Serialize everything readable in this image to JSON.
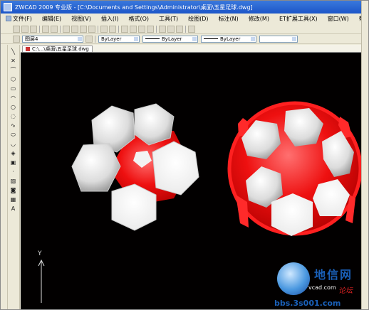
{
  "window": {
    "title": "ZWCAD 2009 专业版 - [C:\\Documents and Settings\\Administrator\\桌面\\五星足球.dwg]"
  },
  "menu": [
    {
      "label": "文件(F)"
    },
    {
      "label": "编辑(E)"
    },
    {
      "label": "视图(V)"
    },
    {
      "label": "插入(I)"
    },
    {
      "label": "格式(O)"
    },
    {
      "label": "工具(T)"
    },
    {
      "label": "绘图(D)"
    },
    {
      "label": "标注(N)"
    },
    {
      "label": "修改(M)"
    },
    {
      "label": "ET扩展工具(X)"
    },
    {
      "label": "窗口(W)"
    },
    {
      "label": "帮助(H)"
    }
  ],
  "toolbar": {
    "layer_value": "图层4",
    "color_value": "ByLayer",
    "linetype_value": "ByLayer",
    "lineweight_value": "ByLayer"
  },
  "document": {
    "tab_label": "C:\\...\\桌面\\五星足球.dwg"
  },
  "ucs": {
    "y_label": "Y"
  },
  "watermark": {
    "site_name": "地信网",
    "sub_label": "vcad.com",
    "tag": "论坛",
    "url": "bbs.3s001.com"
  },
  "colors": {
    "ball_red": "#e60000",
    "ball_white": "#ffffff",
    "canvas": "#020000",
    "title_blue": "#1c56c8"
  },
  "icons": [
    "line-icon",
    "polyline-icon",
    "arc-icon",
    "circle-icon",
    "rectangle-icon",
    "polygon-icon",
    "spline-icon",
    "ellipse-icon",
    "hatch-icon",
    "block-icon",
    "point-icon",
    "text-icon",
    "table-icon",
    "region-icon",
    "insert-icon",
    "attribute-icon"
  ]
}
